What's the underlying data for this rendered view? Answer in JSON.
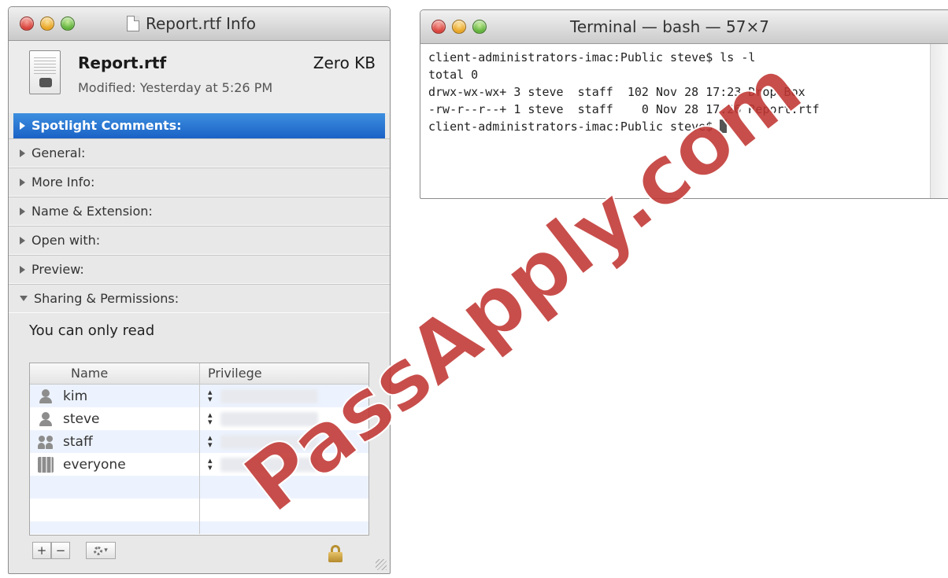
{
  "info_window": {
    "title": "Report.rtf Info",
    "file": {
      "name": "Report.rtf",
      "size": "Zero KB",
      "modified": "Modified: Yesterday at 5:26 PM"
    },
    "sections": [
      {
        "label": "Spotlight Comments:",
        "selected": true
      },
      {
        "label": "General:"
      },
      {
        "label": "More Info:"
      },
      {
        "label": "Name & Extension:"
      },
      {
        "label": "Open with:"
      },
      {
        "label": "Preview:"
      },
      {
        "label": "Sharing & Permissions:",
        "expanded": true
      }
    ],
    "permissions": {
      "note": "You can only read",
      "columns": [
        "Name",
        "Privilege"
      ],
      "rows": [
        {
          "name": "kim",
          "icon": "user-icon"
        },
        {
          "name": "steve",
          "icon": "user-icon"
        },
        {
          "name": "staff",
          "icon": "group-icon"
        },
        {
          "name": "everyone",
          "icon": "everyone-icon"
        }
      ]
    },
    "buttons": {
      "add": "+",
      "remove": "−"
    }
  },
  "terminal": {
    "title": "Terminal — bash — 57×7",
    "lines": [
      "client-administrators-imac:Public steve$ ls -l",
      "total 0",
      "drwx-wx-wx+ 3 steve  staff  102 Nov 28 17:23 Drop Box",
      "-rw-r--r--+ 1 steve  staff    0 Nov 28 17:26 Report.rtf",
      "client-administrators-imac:Public steve$ "
    ]
  },
  "watermark": "PassApply.com"
}
